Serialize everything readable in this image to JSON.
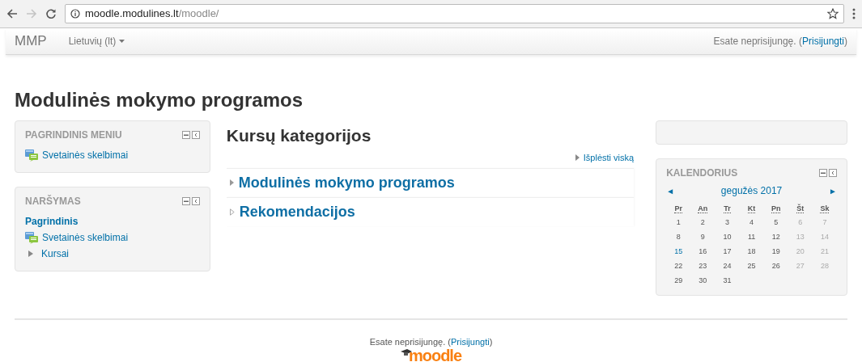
{
  "browser": {
    "url_host": "moodle.modulines.lt",
    "url_path": "/moodle/",
    "forward_disabled": true
  },
  "navbar": {
    "brand": "MMP",
    "language": "Lietuvių (lt)",
    "login_prefix": "Esate neprisijungę. (",
    "login_link": "Prisijungti",
    "login_suffix": ")"
  },
  "page_title": "Modulinės mokymo programos",
  "left_blocks": [
    {
      "title": "PAGRINDINIS MENIU",
      "items": [
        {
          "kind": "forum",
          "label": "Svetainės skelbimai"
        }
      ]
    },
    {
      "title": "NARŠYMAS",
      "items": [
        {
          "kind": "home",
          "label": "Pagrindinis"
        },
        {
          "kind": "forum",
          "label": "Svetainės skelbimai"
        },
        {
          "kind": "branch",
          "label": "Kursai",
          "expanded": false
        }
      ]
    }
  ],
  "main": {
    "heading": "Kursų kategorijos",
    "expand_all": "Išplėsti viską",
    "categories": [
      {
        "name": "Modulinės mokymo programos",
        "has_subcategories": true
      },
      {
        "name": "Rekomendacijos",
        "has_subcategories": false
      }
    ]
  },
  "calendar": {
    "title": "KALENDORIUS",
    "month": "gegužės 2017",
    "prev": "◄",
    "next": "►",
    "weekdays": [
      "Pr",
      "An",
      "Tr",
      "Kt",
      "Pn",
      "Št",
      "Sk"
    ],
    "days": [
      {
        "day": "1",
        "kind": "weekday"
      },
      {
        "day": "2",
        "kind": "weekday"
      },
      {
        "day": "3",
        "kind": "weekday"
      },
      {
        "day": "4",
        "kind": "weekday"
      },
      {
        "day": "5",
        "kind": "weekday"
      },
      {
        "day": "6",
        "kind": "weekend"
      },
      {
        "day": "7",
        "kind": "weekend"
      },
      {
        "day": "8",
        "kind": "weekday"
      },
      {
        "day": "9",
        "kind": "weekday"
      },
      {
        "day": "10",
        "kind": "weekday"
      },
      {
        "day": "11",
        "kind": "weekday"
      },
      {
        "day": "12",
        "kind": "weekday"
      },
      {
        "day": "13",
        "kind": "weekend"
      },
      {
        "day": "14",
        "kind": "weekend"
      },
      {
        "day": "15",
        "kind": "today"
      },
      {
        "day": "16",
        "kind": "weekday"
      },
      {
        "day": "17",
        "kind": "weekday"
      },
      {
        "day": "18",
        "kind": "weekday"
      },
      {
        "day": "19",
        "kind": "weekday"
      },
      {
        "day": "20",
        "kind": "weekend"
      },
      {
        "day": "21",
        "kind": "weekend"
      },
      {
        "day": "22",
        "kind": "weekday"
      },
      {
        "day": "23",
        "kind": "weekday"
      },
      {
        "day": "24",
        "kind": "weekday"
      },
      {
        "day": "25",
        "kind": "weekday"
      },
      {
        "day": "26",
        "kind": "weekday"
      },
      {
        "day": "27",
        "kind": "weekend"
      },
      {
        "day": "28",
        "kind": "weekend"
      },
      {
        "day": "29",
        "kind": "weekday"
      },
      {
        "day": "30",
        "kind": "weekday"
      },
      {
        "day": "31",
        "kind": "weekday"
      }
    ]
  },
  "footer": {
    "login_prefix": "Esate neprisijungę. (",
    "login_link": "Prisijungti",
    "login_suffix": ")",
    "logo": "moodle"
  }
}
